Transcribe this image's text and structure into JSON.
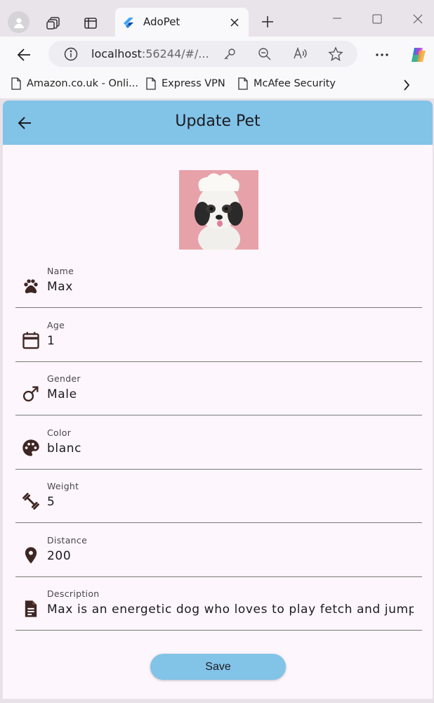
{
  "browser": {
    "tab_title": "AdoPet",
    "url_host": "localhost",
    "url_rest": ":56244/#/...",
    "bookmarks": [
      {
        "label": "Amazon.co.uk - Onli..."
      },
      {
        "label": "Express VPN"
      },
      {
        "label": "McAfee Security"
      }
    ]
  },
  "app": {
    "title": "Update Pet",
    "fields": {
      "name": {
        "label": "Name",
        "value": "Max",
        "icon": "paw-icon"
      },
      "age": {
        "label": "Age",
        "value": "1",
        "icon": "calendar-icon"
      },
      "gender": {
        "label": "Gender",
        "value": "Male",
        "icon": "male-icon"
      },
      "color": {
        "label": "Color",
        "value": "blanc",
        "icon": "palette-icon"
      },
      "weight": {
        "label": "Weight",
        "value": "5",
        "icon": "fitness-icon"
      },
      "distance": {
        "label": "Distance",
        "value": "200",
        "icon": "location-pin-icon"
      },
      "description": {
        "label": "Description",
        "value": "Max is an energetic dog who loves to play fetch and jump into",
        "icon": "document-icon"
      }
    },
    "save_label": "Save"
  },
  "colors": {
    "app_bar": "#82c3e8",
    "background": "#fdf6fc",
    "icon": "#3e2723"
  }
}
